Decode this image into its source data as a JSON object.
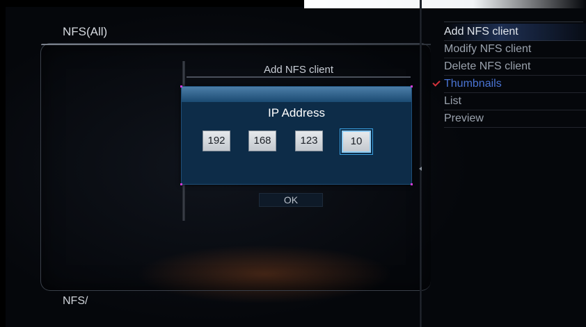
{
  "browser": {
    "title": "NFS(All)",
    "footer": "NFS/"
  },
  "dialog": {
    "title": "Add NFS client",
    "popup": {
      "label": "IP Address",
      "octets": [
        "192",
        "168",
        "123",
        "10"
      ],
      "selected_index": 3
    },
    "ok_label": "OK"
  },
  "menu": {
    "items": [
      {
        "label": "Add NFS client",
        "state": "focused"
      },
      {
        "label": "Modify NFS client",
        "state": "normal"
      },
      {
        "label": "Delete NFS client",
        "state": "normal"
      },
      {
        "label": "Thumbnails",
        "state": "checked"
      },
      {
        "label": "List",
        "state": "normal"
      },
      {
        "label": "Preview",
        "state": "normal"
      }
    ]
  },
  "colors": {
    "popup_bg": "#0d2c48",
    "popup_header": "#4c7ea8",
    "accent_blue": "#4a74d4",
    "check_red": "#d2323b",
    "corner_magenta": "#d03ad6"
  }
}
